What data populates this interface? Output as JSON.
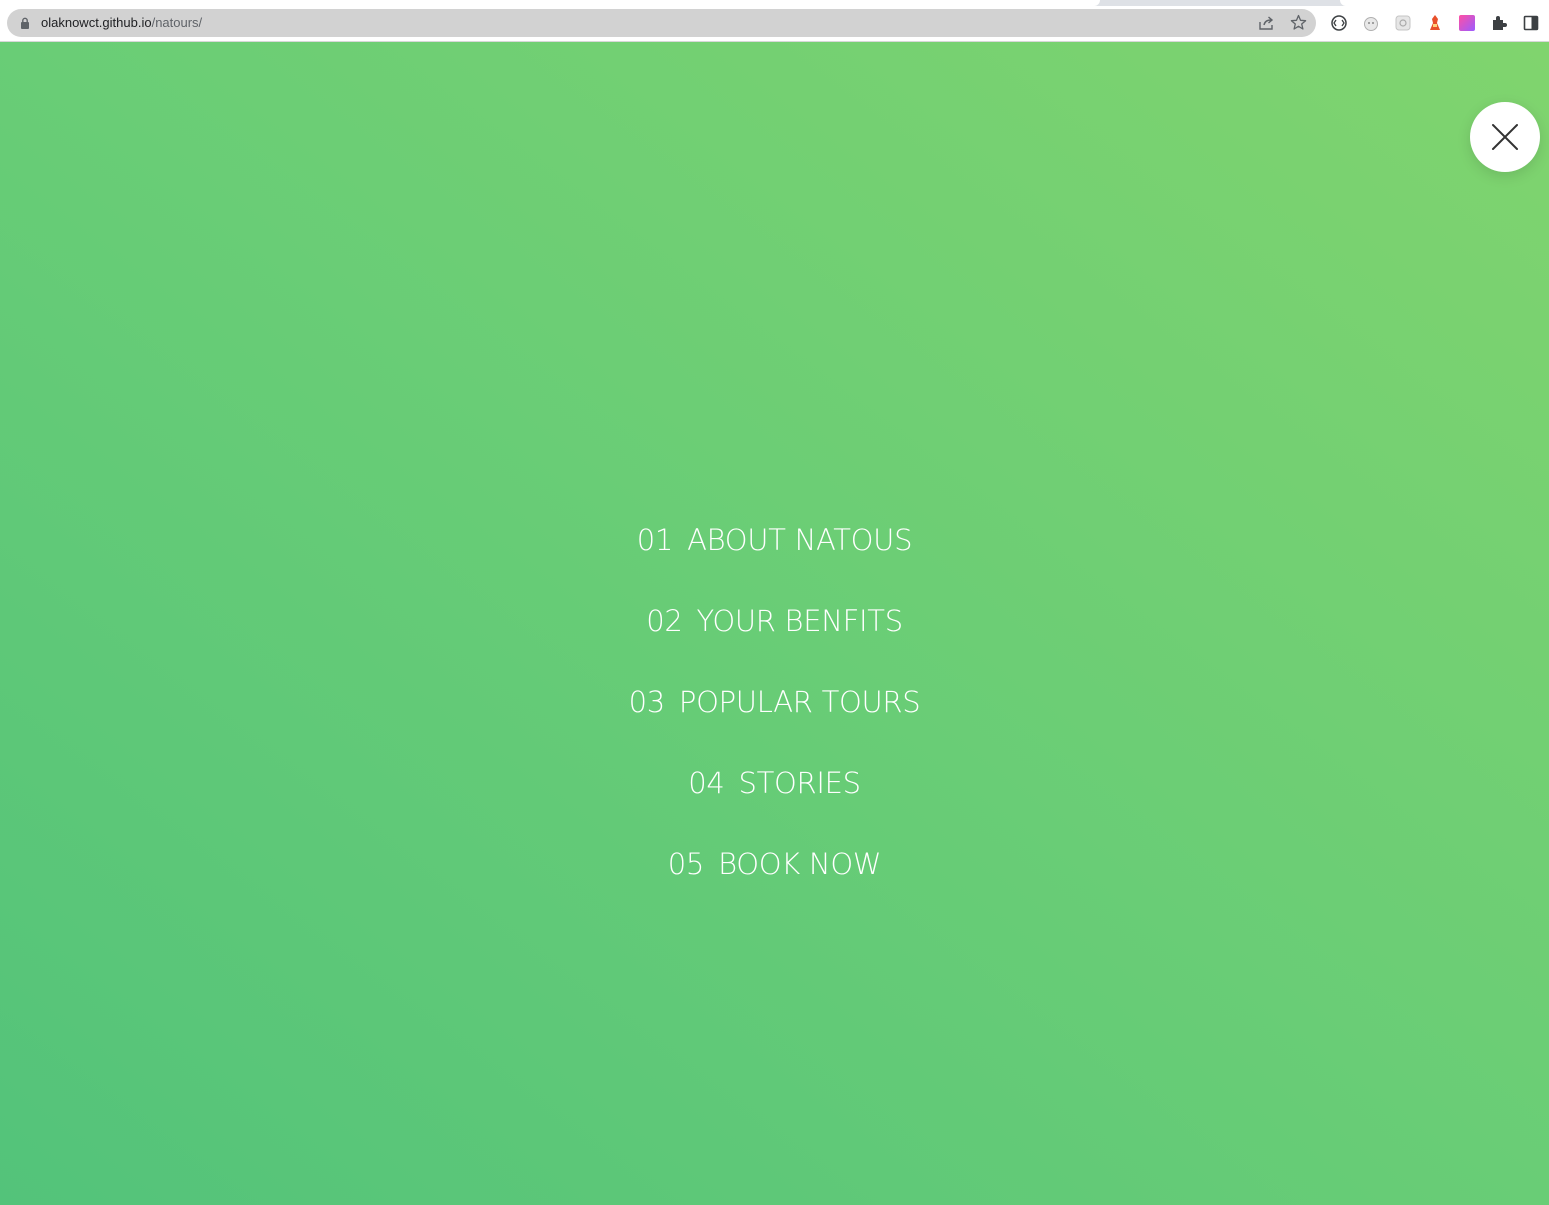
{
  "browser": {
    "url_host": "olaknowct.github.io",
    "url_path": "/natours/",
    "icons": [
      "lock-icon",
      "share-icon",
      "bookmark-star-icon",
      "extension-1-icon",
      "extension-2-icon",
      "extension-3-icon",
      "extension-4-icon",
      "extension-5-icon",
      "extensions-puzzle-icon",
      "side-panel-icon"
    ]
  },
  "navigation": {
    "close_icon": "close-icon",
    "items": [
      {
        "number": "01",
        "label": "ABOUT NATOUS"
      },
      {
        "number": "02",
        "label": "YOUR BENFITS"
      },
      {
        "number": "03",
        "label": "POPULAR TOURS"
      },
      {
        "number": "04",
        "label": "STORIES"
      },
      {
        "number": "05",
        "label": "BOOK NOW"
      }
    ]
  },
  "colors": {
    "gradient_start": "#53c37a",
    "gradient_end": "#80d46e",
    "text": "#ffffff",
    "close_button_bg": "#ffffff",
    "close_icon": "#333333"
  }
}
